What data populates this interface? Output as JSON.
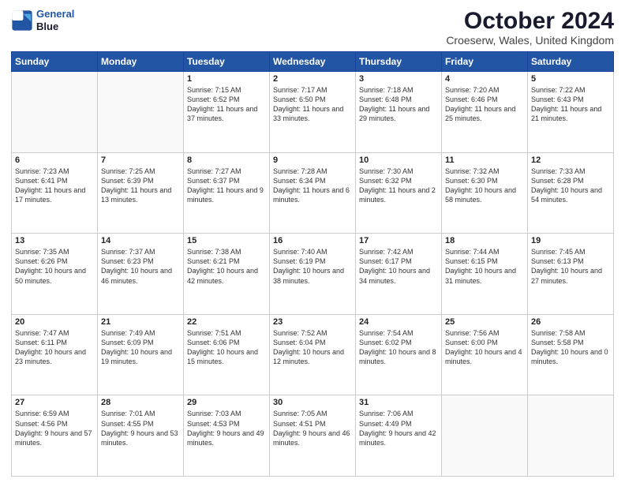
{
  "header": {
    "logo_line1": "General",
    "logo_line2": "Blue",
    "title": "October 2024",
    "subtitle": "Croeserw, Wales, United Kingdom"
  },
  "days": [
    "Sunday",
    "Monday",
    "Tuesday",
    "Wednesday",
    "Thursday",
    "Friday",
    "Saturday"
  ],
  "weeks": [
    [
      {
        "day": "",
        "text": ""
      },
      {
        "day": "",
        "text": ""
      },
      {
        "day": "1",
        "text": "Sunrise: 7:15 AM\nSunset: 6:52 PM\nDaylight: 11 hours\nand 37 minutes."
      },
      {
        "day": "2",
        "text": "Sunrise: 7:17 AM\nSunset: 6:50 PM\nDaylight: 11 hours\nand 33 minutes."
      },
      {
        "day": "3",
        "text": "Sunrise: 7:18 AM\nSunset: 6:48 PM\nDaylight: 11 hours\nand 29 minutes."
      },
      {
        "day": "4",
        "text": "Sunrise: 7:20 AM\nSunset: 6:46 PM\nDaylight: 11 hours\nand 25 minutes."
      },
      {
        "day": "5",
        "text": "Sunrise: 7:22 AM\nSunset: 6:43 PM\nDaylight: 11 hours\nand 21 minutes."
      }
    ],
    [
      {
        "day": "6",
        "text": "Sunrise: 7:23 AM\nSunset: 6:41 PM\nDaylight: 11 hours\nand 17 minutes."
      },
      {
        "day": "7",
        "text": "Sunrise: 7:25 AM\nSunset: 6:39 PM\nDaylight: 11 hours\nand 13 minutes."
      },
      {
        "day": "8",
        "text": "Sunrise: 7:27 AM\nSunset: 6:37 PM\nDaylight: 11 hours\nand 9 minutes."
      },
      {
        "day": "9",
        "text": "Sunrise: 7:28 AM\nSunset: 6:34 PM\nDaylight: 11 hours\nand 6 minutes."
      },
      {
        "day": "10",
        "text": "Sunrise: 7:30 AM\nSunset: 6:32 PM\nDaylight: 11 hours\nand 2 minutes."
      },
      {
        "day": "11",
        "text": "Sunrise: 7:32 AM\nSunset: 6:30 PM\nDaylight: 10 hours\nand 58 minutes."
      },
      {
        "day": "12",
        "text": "Sunrise: 7:33 AM\nSunset: 6:28 PM\nDaylight: 10 hours\nand 54 minutes."
      }
    ],
    [
      {
        "day": "13",
        "text": "Sunrise: 7:35 AM\nSunset: 6:26 PM\nDaylight: 10 hours\nand 50 minutes."
      },
      {
        "day": "14",
        "text": "Sunrise: 7:37 AM\nSunset: 6:23 PM\nDaylight: 10 hours\nand 46 minutes."
      },
      {
        "day": "15",
        "text": "Sunrise: 7:38 AM\nSunset: 6:21 PM\nDaylight: 10 hours\nand 42 minutes."
      },
      {
        "day": "16",
        "text": "Sunrise: 7:40 AM\nSunset: 6:19 PM\nDaylight: 10 hours\nand 38 minutes."
      },
      {
        "day": "17",
        "text": "Sunrise: 7:42 AM\nSunset: 6:17 PM\nDaylight: 10 hours\nand 34 minutes."
      },
      {
        "day": "18",
        "text": "Sunrise: 7:44 AM\nSunset: 6:15 PM\nDaylight: 10 hours\nand 31 minutes."
      },
      {
        "day": "19",
        "text": "Sunrise: 7:45 AM\nSunset: 6:13 PM\nDaylight: 10 hours\nand 27 minutes."
      }
    ],
    [
      {
        "day": "20",
        "text": "Sunrise: 7:47 AM\nSunset: 6:11 PM\nDaylight: 10 hours\nand 23 minutes."
      },
      {
        "day": "21",
        "text": "Sunrise: 7:49 AM\nSunset: 6:09 PM\nDaylight: 10 hours\nand 19 minutes."
      },
      {
        "day": "22",
        "text": "Sunrise: 7:51 AM\nSunset: 6:06 PM\nDaylight: 10 hours\nand 15 minutes."
      },
      {
        "day": "23",
        "text": "Sunrise: 7:52 AM\nSunset: 6:04 PM\nDaylight: 10 hours\nand 12 minutes."
      },
      {
        "day": "24",
        "text": "Sunrise: 7:54 AM\nSunset: 6:02 PM\nDaylight: 10 hours\nand 8 minutes."
      },
      {
        "day": "25",
        "text": "Sunrise: 7:56 AM\nSunset: 6:00 PM\nDaylight: 10 hours\nand 4 minutes."
      },
      {
        "day": "26",
        "text": "Sunrise: 7:58 AM\nSunset: 5:58 PM\nDaylight: 10 hours\nand 0 minutes."
      }
    ],
    [
      {
        "day": "27",
        "text": "Sunrise: 6:59 AM\nSunset: 4:56 PM\nDaylight: 9 hours\nand 57 minutes."
      },
      {
        "day": "28",
        "text": "Sunrise: 7:01 AM\nSunset: 4:55 PM\nDaylight: 9 hours\nand 53 minutes."
      },
      {
        "day": "29",
        "text": "Sunrise: 7:03 AM\nSunset: 4:53 PM\nDaylight: 9 hours\nand 49 minutes."
      },
      {
        "day": "30",
        "text": "Sunrise: 7:05 AM\nSunset: 4:51 PM\nDaylight: 9 hours\nand 46 minutes."
      },
      {
        "day": "31",
        "text": "Sunrise: 7:06 AM\nSunset: 4:49 PM\nDaylight: 9 hours\nand 42 minutes."
      },
      {
        "day": "",
        "text": ""
      },
      {
        "day": "",
        "text": ""
      }
    ]
  ]
}
